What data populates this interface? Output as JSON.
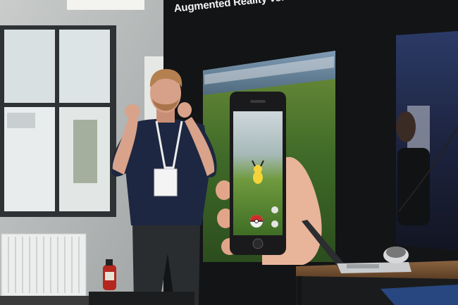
{
  "slide": {
    "title": "Augmented Reality vs. Virtual Reality"
  },
  "colors": {
    "wall": "#b9bcbc",
    "window_frame": "#2f3235",
    "screen_dark": "#121416",
    "slide_grass": "#4f7a2f",
    "shirt_navy": "#1d2741",
    "table_wood": "#6a4a2e",
    "extinguisher_red": "#b5261f"
  },
  "scene_objects": [
    "window-icon",
    "radiator-icon",
    "fire-extinguisher-icon",
    "speaker-person",
    "lanyard-badge-icon",
    "projection-screen",
    "smartphone-icon",
    "pikachu-icon",
    "pokeball-icon",
    "side-screen",
    "laptop-icon",
    "clicker-device-icon",
    "presentation-table"
  ]
}
